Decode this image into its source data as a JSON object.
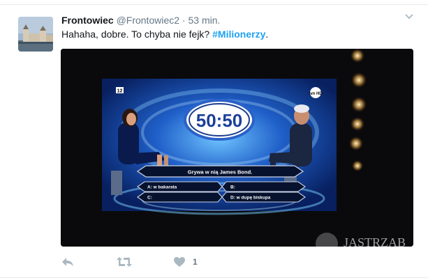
{
  "tweet": {
    "display_name": "Frontowiec",
    "handle": "@Frontowiec2",
    "separator": "·",
    "time": "53 min.",
    "text_prefix": "Hahaha, dobre. To chyba nie fejk?",
    "hashtag": "#Milionerzy",
    "text_suffix": "."
  },
  "media": {
    "lifeline": "50:50",
    "channel_logo": "tvn HD",
    "age_rating": "12",
    "question": "Grywa w nią James Bond.",
    "answers": {
      "a": "A: w bakarata",
      "b": "B:",
      "c": "C:",
      "d": "D: w dupę biskupa"
    },
    "watermark": "JASTRZĄB"
  },
  "actions": {
    "reply_icon": "reply-icon",
    "retweet_icon": "retweet-icon",
    "like_icon": "heart-icon",
    "like_count": "1"
  },
  "colors": {
    "link": "#1da1f2",
    "meta": "#657786",
    "icon": "#aab8c2",
    "divider": "#e6ecf0"
  }
}
